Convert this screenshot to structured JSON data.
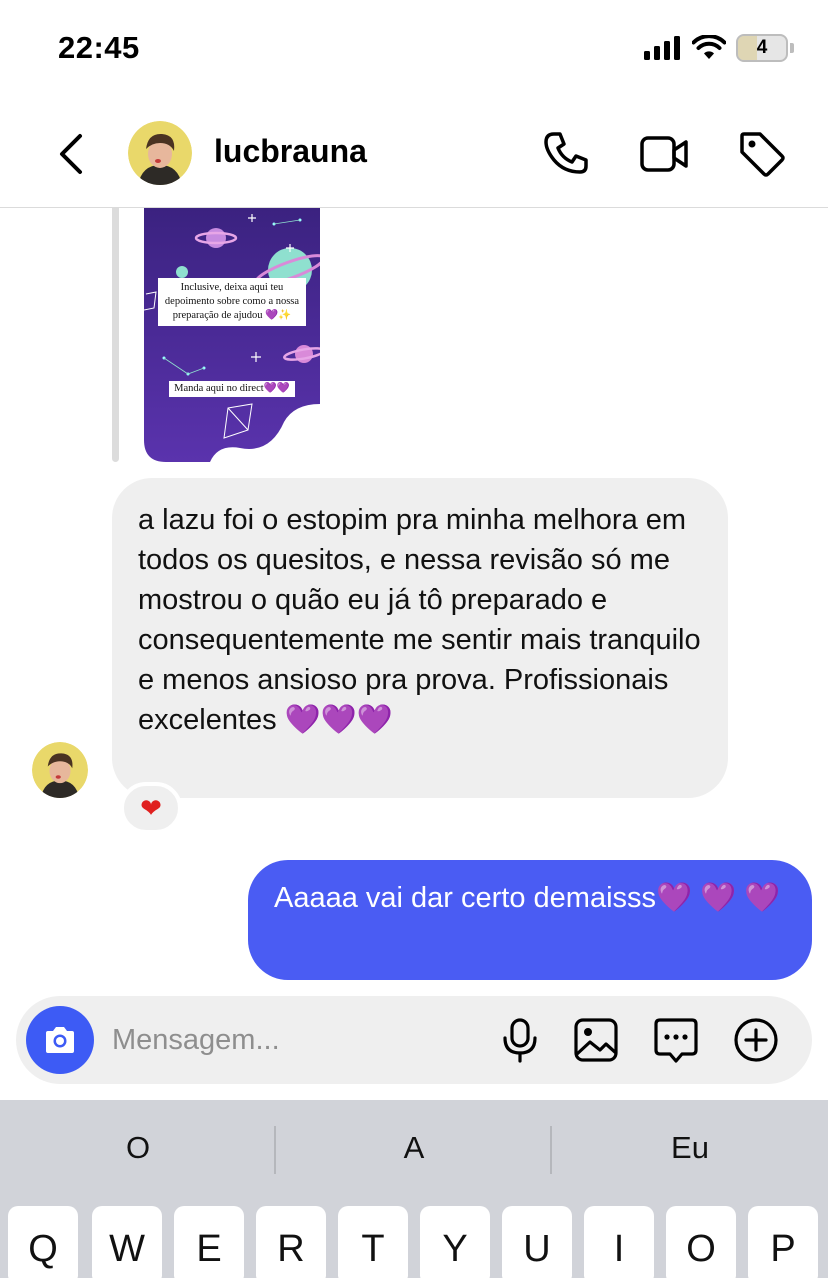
{
  "status_bar": {
    "time": "22:45",
    "battery_level": "4"
  },
  "header": {
    "username": "lucbrauna"
  },
  "story": {
    "caption_main": "Inclusive, deixa aqui teu depoimento sobre como a nossa preparação de ajudou 💜✨",
    "caption_cta": "Manda aqui no direct💜💜"
  },
  "messages": {
    "received_text": "a lazu foi o estopim pra minha melhora em todos os quesitos, e nessa revisão só me mostrou o quão eu já tô preparado e consequentemente me sentir mais tranquilo e menos ansioso pra prova. Profissionais excelentes 💜💜💜",
    "received_reaction": "❤",
    "sent_text": "Aaaaa vai dar certo demaisss💜 💜 💜"
  },
  "composer": {
    "placeholder": "Mensagem..."
  },
  "keyboard": {
    "suggestions": [
      "O",
      "A",
      "Eu"
    ],
    "row1": [
      "Q",
      "W",
      "E",
      "R",
      "T",
      "Y",
      "U",
      "I",
      "O",
      "P"
    ]
  },
  "colors": {
    "sent_bubble": "#4a5cf3",
    "received_bubble": "#efefef",
    "camera_button": "#3d5bf5",
    "story_background": "#4b2a93"
  }
}
